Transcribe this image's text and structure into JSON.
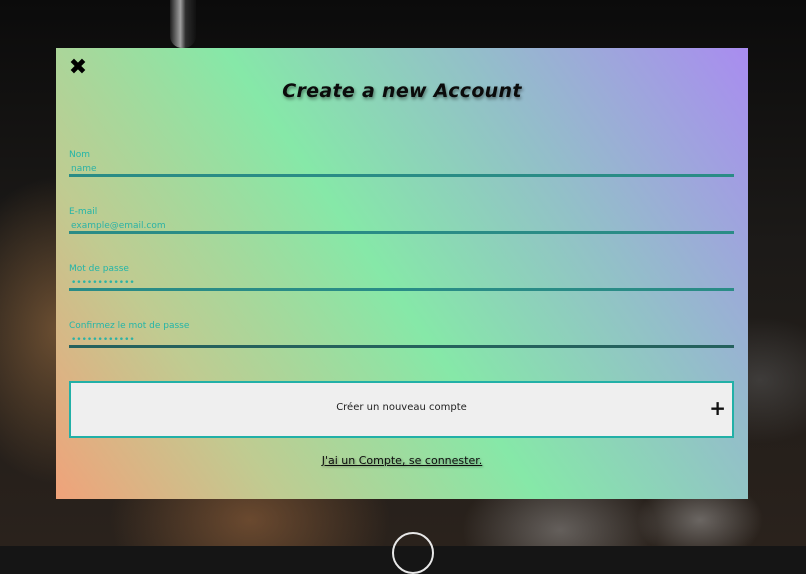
{
  "modal": {
    "close_icon": "close-icon",
    "title": "Create a new Account",
    "fields": [
      {
        "label": "Nom",
        "placeholder": "name",
        "type": "text"
      },
      {
        "label": "E-mail",
        "placeholder": "example@email.com",
        "type": "email"
      },
      {
        "label": "Mot de passe",
        "placeholder": "••••••••••••",
        "type": "password"
      },
      {
        "label": "Confirmez le mot de passe",
        "placeholder": "••••••••••••",
        "type": "password"
      }
    ],
    "submit": {
      "label": "Créer un nouveau compte",
      "icon": "plus-icon"
    },
    "login_link": "J'ai un Compte, se connester."
  },
  "colors": {
    "accent": "#22b0a7",
    "gradient": [
      "#f0a27a",
      "#c0cb91",
      "#86e8a8",
      "#93bfc9",
      "#a98cf0"
    ]
  }
}
